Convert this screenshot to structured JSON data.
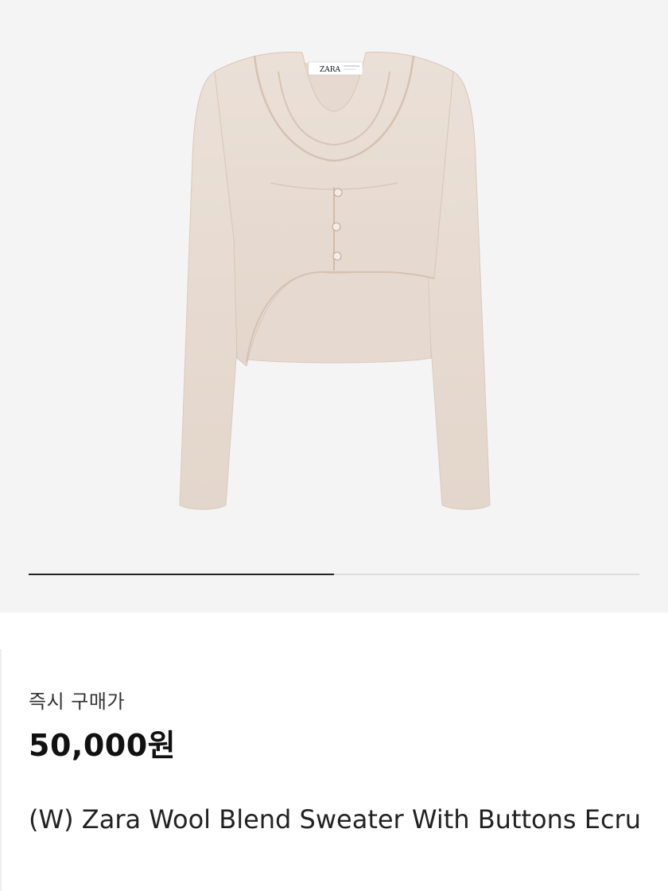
{
  "gallery": {
    "image_alt": "ecru wool blend cropped sweater with buttons",
    "brand_tag": "ZARA",
    "progress": 0.5
  },
  "price": {
    "label": "즉시 구매가",
    "value": "50,000원"
  },
  "product": {
    "name": "(W) Zara Wool Blend Sweater With Buttons Ecru"
  },
  "colors": {
    "gallery_bg": "#f4f4f4",
    "sweater": "#e8dcd2",
    "progress_fill": "#222222",
    "progress_track": "#dddddd"
  }
}
